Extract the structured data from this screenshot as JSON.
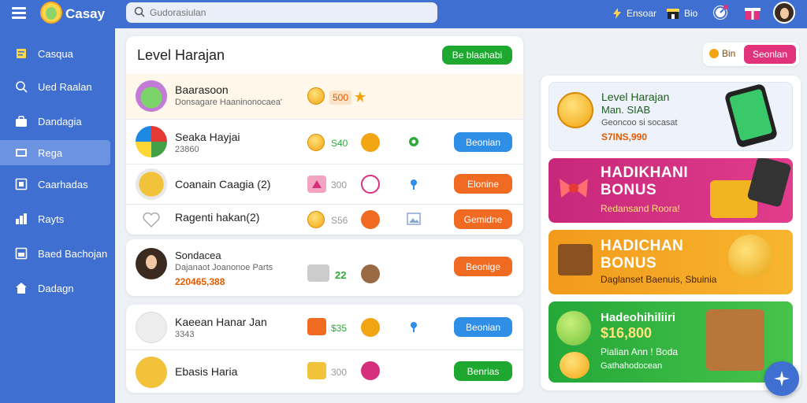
{
  "app": {
    "name": "Casay"
  },
  "search": {
    "placeholder": "Gudorasiulan"
  },
  "topbar": {
    "items": [
      {
        "label": "Ensoar",
        "icon": "bolt-icon"
      },
      {
        "label": "Bio",
        "icon": "shop-icon"
      }
    ],
    "badges": [
      "timer-icon",
      "gift-icon"
    ]
  },
  "sidebar": {
    "items": [
      {
        "label": "Casqua",
        "icon": "note-icon"
      },
      {
        "label": "Ued Raalan",
        "icon": "search-icon"
      },
      {
        "label": "Dandagia",
        "icon": "bag-icon"
      },
      {
        "label": "Rega",
        "icon": "chart-icon",
        "active": true
      },
      {
        "label": "Caarhadas",
        "icon": "frame-icon"
      },
      {
        "label": "Rayts",
        "icon": "stats-icon"
      },
      {
        "label": "Baed Bachojan",
        "icon": "window-icon"
      },
      {
        "label": "Dadagn",
        "icon": "home-icon"
      }
    ]
  },
  "leaderboard": {
    "title": "Level Harajan",
    "header_button": "Be blaahabi",
    "rows": [
      {
        "name": "Baarasoon",
        "sub": "Donsagare Haaninonocaea'",
        "points": "500",
        "button": ""
      },
      {
        "name": "Seaka Hayjai",
        "sub": "23860",
        "points": "S40",
        "button": "Beonian"
      },
      {
        "name": "Coanain Caagia (2)",
        "sub": "",
        "points": "300",
        "button": "Elonine"
      },
      {
        "name": "Ragenti hakan(2)",
        "sub": "",
        "points": "S56",
        "button": "Gemidne"
      }
    ]
  },
  "featured": {
    "name": "Sondacea",
    "sub": "Dajanaot Joanonoe Parts",
    "value": "220465,388",
    "points": "22",
    "button": "Beonige"
  },
  "bottom_rows": [
    {
      "name": "Kaeean Hanar Jan",
      "sub": "3343",
      "points": "$35",
      "button": "Beonian"
    },
    {
      "name": "Ebasis Haria",
      "sub": "",
      "points": "300",
      "button": "Benrias"
    }
  ],
  "right_top": {
    "label": "Bin",
    "button": "Seonlan"
  },
  "promos": [
    {
      "title": "Level Harajan",
      "line2": "Man. SIAB",
      "line3": "Geoncoo si socasat",
      "line4": "S7INS,990",
      "color": "#eef3fb"
    },
    {
      "title": "HADIKHANI",
      "line2": "BONUS",
      "line3": "Redansand Roora!",
      "color": "#d62f7e"
    },
    {
      "title": "HADICHAN",
      "line2": "BONUS",
      "line3": "Daglanset Baenuis, Sbuinia",
      "color": "#f59a1c"
    },
    {
      "title": "Hadeohihiliiri",
      "line2": "$16,800",
      "line3": "Pialian Ann ! Boda",
      "line4": "Gathahodocean",
      "color": "#2faa3a"
    }
  ],
  "colors": {
    "primary": "#3f6fd0",
    "green": "#1fa82f",
    "blue_btn": "#2f8ee6",
    "orange_btn": "#f06a22",
    "pink": "#e0337c"
  }
}
